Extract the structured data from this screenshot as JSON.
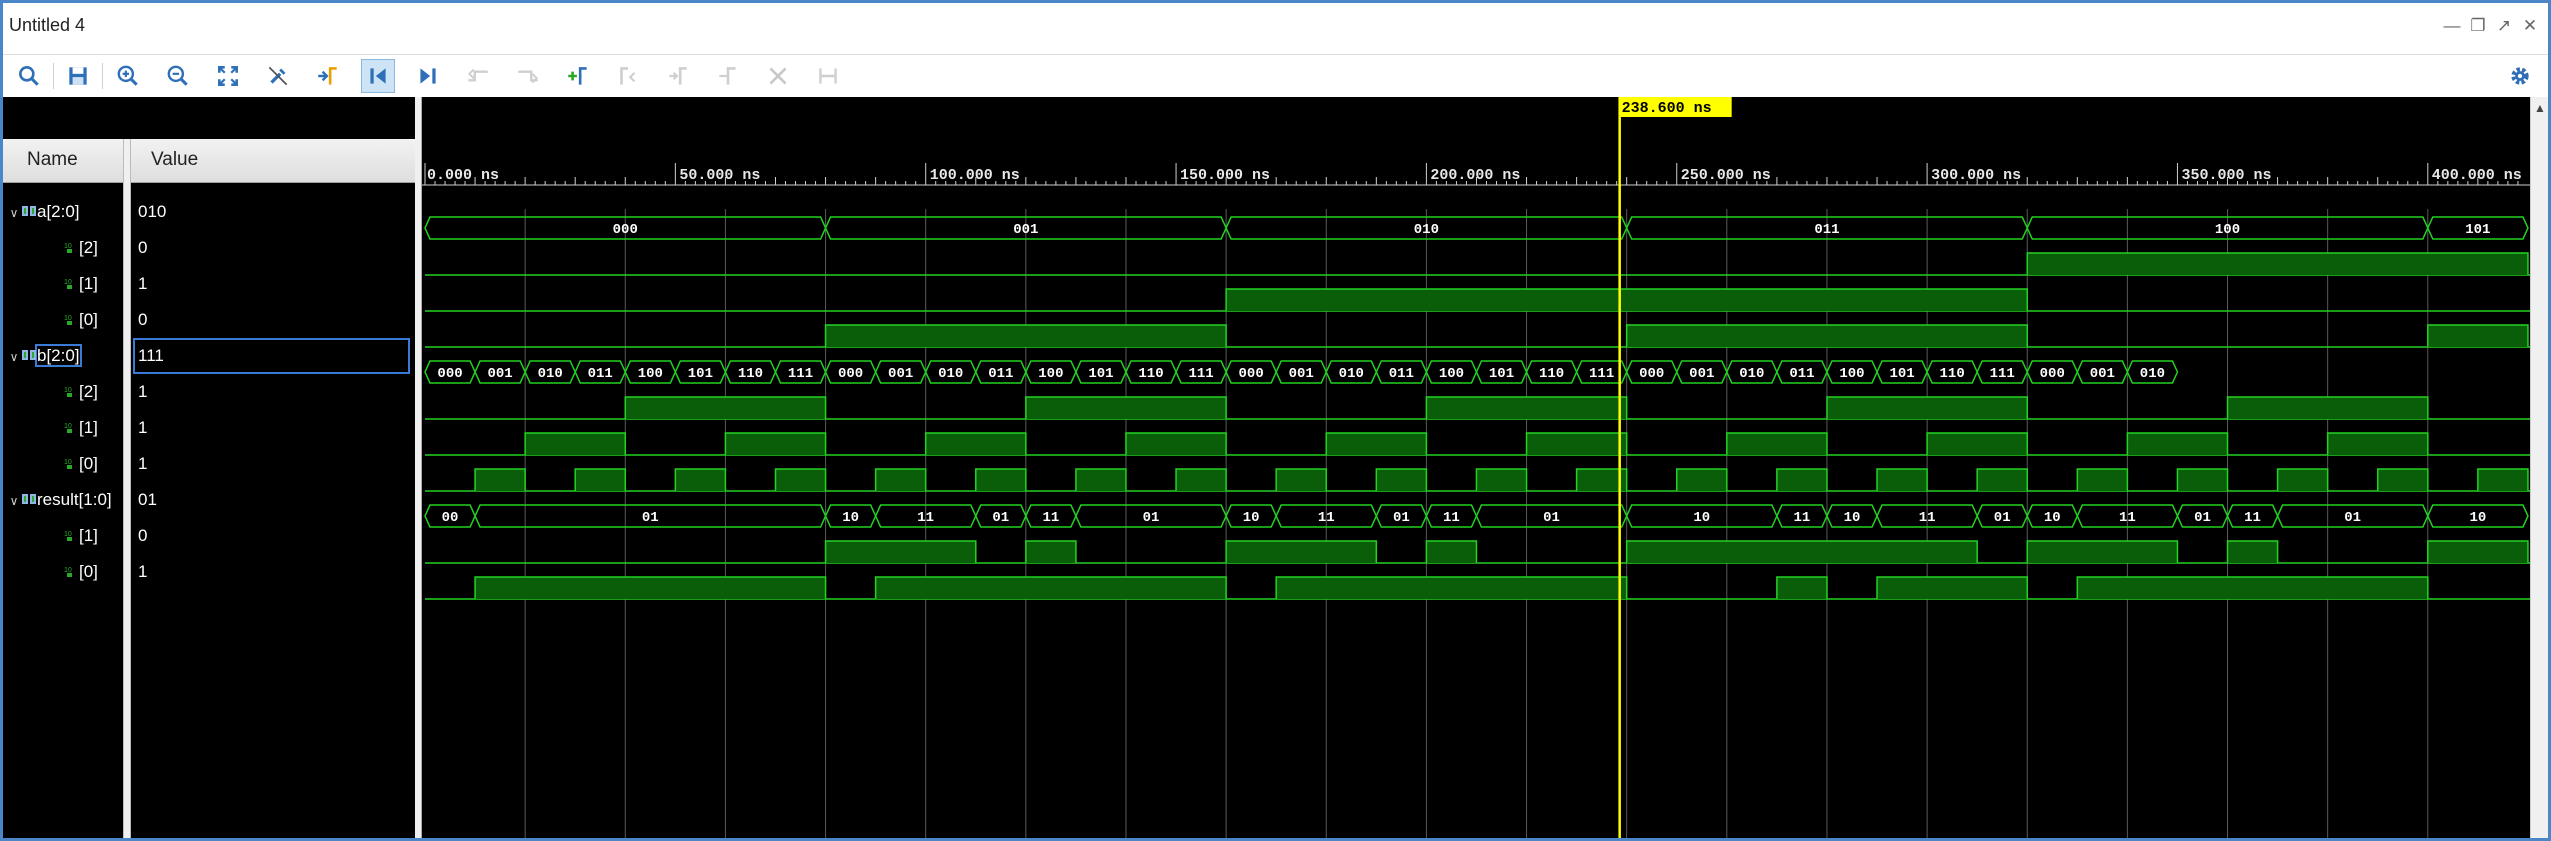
{
  "window": {
    "title": "Untitled 4"
  },
  "toolbar": {
    "icons": [
      "search-icon",
      "save-icon",
      "zoom-in-icon",
      "zoom-out-icon",
      "zoom-fit-icon",
      "no-snap-icon",
      "go-to-cursor-icon",
      "go-to-time-zero-icon",
      "go-to-last-time-icon",
      "previous-transition-icon",
      "next-transition-icon",
      "add-marker-icon",
      "previous-marker-icon",
      "next-marker-icon",
      "swap-cursors-icon",
      "cut-icon",
      "delete-all-markers-icon",
      "settings-icon"
    ]
  },
  "columns": {
    "name": "Name",
    "value": "Value"
  },
  "signals": [
    {
      "name": "a[2:0]",
      "value": "010"
    },
    {
      "name": "[2]",
      "value": "0"
    },
    {
      "name": "[1]",
      "value": "1"
    },
    {
      "name": "[0]",
      "value": "0"
    },
    {
      "name": "b[2:0]",
      "value": "111"
    },
    {
      "name": "[2]",
      "value": "1"
    },
    {
      "name": "[1]",
      "value": "1"
    },
    {
      "name": "[0]",
      "value": "1"
    },
    {
      "name": "result[1:0]",
      "value": "01"
    },
    {
      "name": "[1]",
      "value": "0"
    },
    {
      "name": "[0]",
      "value": "1"
    }
  ],
  "cursor": {
    "time": 238.6,
    "label": "238.600 ns"
  },
  "timescale": {
    "start": 0,
    "end": 420,
    "ticks": [
      "0.000 ns",
      "50.000 ns",
      "100.000 ns",
      "150.000 ns",
      "200.000 ns",
      "250.000 ns",
      "300.000 ns",
      "350.000 ns",
      "400.000 ns"
    ]
  },
  "waves": {
    "a_bus": [
      [
        "000",
        0,
        80
      ],
      [
        "001",
        80,
        160
      ],
      [
        "010",
        160,
        240
      ],
      [
        "011",
        240,
        320
      ],
      [
        "100",
        320,
        400
      ],
      [
        "101",
        400,
        420
      ]
    ],
    "b_bus_labels": [
      "000",
      "001",
      "010",
      "011",
      "100",
      "101",
      "110",
      "111",
      "000",
      "001",
      "010",
      "011",
      "100",
      "101",
      "110",
      "111",
      "000",
      "001",
      "010",
      "011",
      "100",
      "101",
      "110",
      "111",
      "000",
      "001",
      "010",
      "011",
      "100",
      "101",
      "110",
      "111",
      "000",
      "001",
      "010"
    ],
    "result_bus": [
      [
        "00",
        0,
        10
      ],
      [
        "01",
        10,
        80
      ],
      [
        "10",
        80,
        90
      ],
      [
        "11",
        90,
        110
      ],
      [
        "01",
        110,
        120
      ],
      [
        "11",
        120,
        130
      ],
      [
        "01",
        130,
        160
      ],
      [
        "10",
        160,
        170
      ],
      [
        "11",
        170,
        190
      ],
      [
        "01",
        190,
        200
      ],
      [
        "11",
        200,
        210
      ],
      [
        "01",
        210,
        240
      ],
      [
        "10",
        240,
        270
      ],
      [
        "11",
        270,
        280
      ],
      [
        "10",
        280,
        290
      ],
      [
        "11",
        290,
        310
      ],
      [
        "01",
        310,
        320
      ],
      [
        "10",
        320,
        330
      ],
      [
        "11",
        330,
        350
      ],
      [
        "01",
        350,
        360
      ],
      [
        "11",
        360,
        370
      ],
      [
        "01",
        370,
        400
      ],
      [
        "10",
        400,
        420
      ]
    ],
    "a2": [
      [
        320,
        420
      ]
    ],
    "a1": [
      [
        160,
        320
      ]
    ],
    "a0": [
      [
        80,
        160
      ],
      [
        240,
        320
      ],
      [
        400,
        420
      ]
    ],
    "b2": [
      [
        40,
        80
      ],
      [
        120,
        160
      ],
      [
        200,
        240
      ],
      [
        280,
        320
      ],
      [
        360,
        400
      ]
    ],
    "b1": [
      [
        20,
        40
      ],
      [
        60,
        80
      ],
      [
        100,
        120
      ],
      [
        140,
        160
      ],
      [
        180,
        200
      ],
      [
        220,
        240
      ],
      [
        260,
        280
      ],
      [
        300,
        320
      ],
      [
        340,
        360
      ],
      [
        380,
        400
      ],
      [
        420,
        420
      ]
    ],
    "b0": [
      [
        10,
        20
      ],
      [
        30,
        40
      ],
      [
        50,
        60
      ],
      [
        70,
        80
      ],
      [
        90,
        100
      ],
      [
        110,
        120
      ],
      [
        130,
        140
      ],
      [
        150,
        160
      ],
      [
        170,
        180
      ],
      [
        190,
        200
      ],
      [
        210,
        220
      ],
      [
        230,
        240
      ],
      [
        250,
        260
      ],
      [
        270,
        280
      ],
      [
        290,
        300
      ],
      [
        310,
        320
      ],
      [
        330,
        340
      ],
      [
        350,
        360
      ],
      [
        370,
        380
      ],
      [
        390,
        400
      ],
      [
        410,
        420
      ]
    ],
    "r1": [
      [
        80,
        110
      ],
      [
        120,
        130
      ],
      [
        160,
        190
      ],
      [
        200,
        210
      ],
      [
        240,
        310
      ],
      [
        320,
        350
      ],
      [
        360,
        370
      ],
      [
        400,
        420
      ]
    ],
    "r0": [
      [
        10,
        80
      ],
      [
        90,
        160
      ],
      [
        170,
        240
      ],
      [
        270,
        280
      ],
      [
        290,
        320
      ],
      [
        330,
        400
      ]
    ]
  }
}
